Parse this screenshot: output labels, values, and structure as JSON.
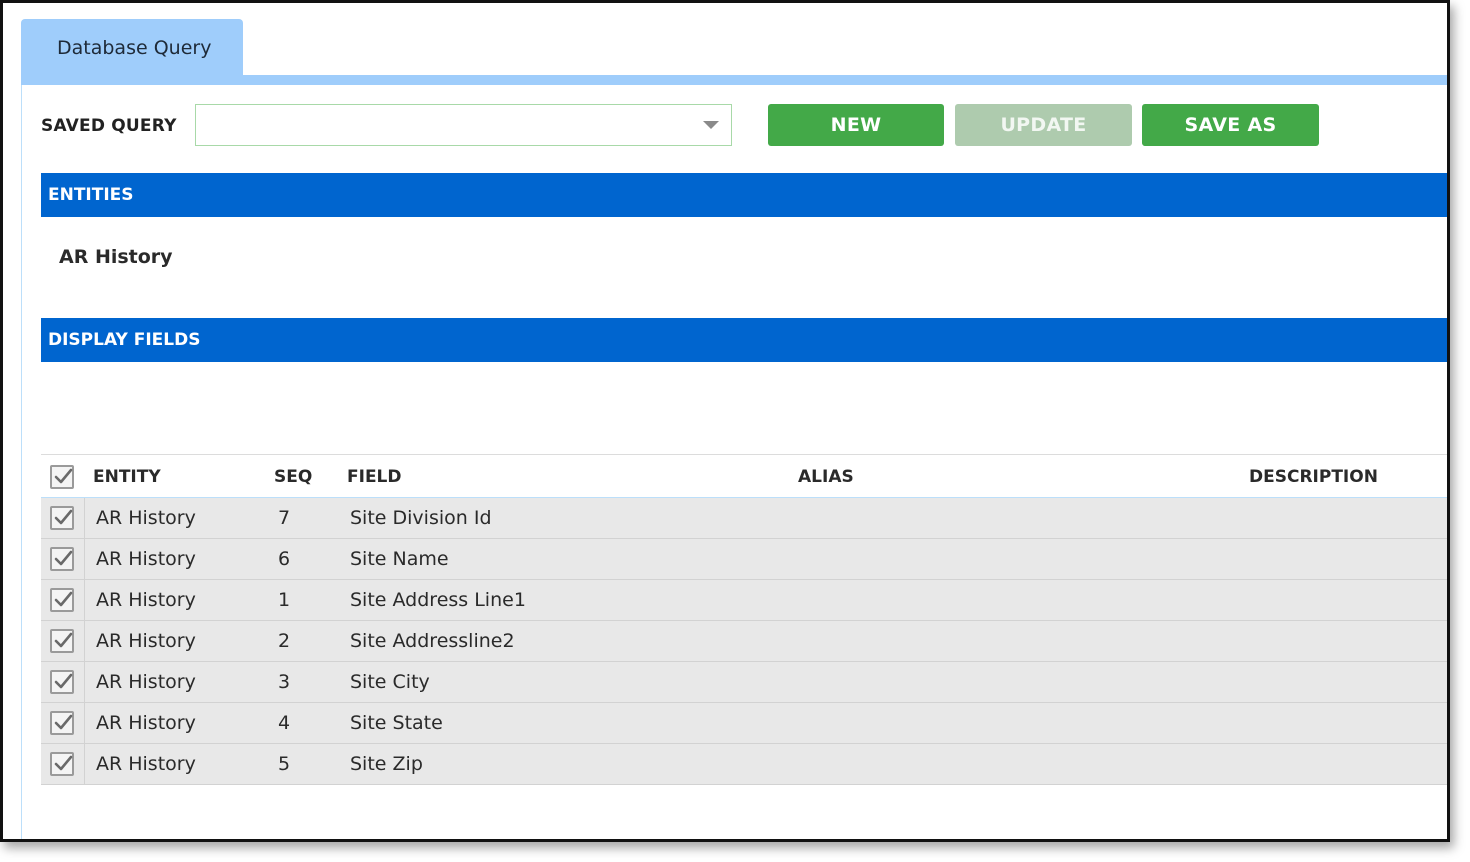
{
  "tab": {
    "label": "Database Query"
  },
  "saved_query": {
    "label": "SAVED QUERY",
    "value": ""
  },
  "buttons": {
    "new": "NEW",
    "update": "UPDATE",
    "save_as": "SAVE AS"
  },
  "sections": {
    "entities": "ENTITIES",
    "display_fields": "DISPLAY FIELDS"
  },
  "entities": [
    "AR History"
  ],
  "table": {
    "headers": {
      "entity": "ENTITY",
      "seq": "SEQ",
      "field": "FIELD",
      "alias": "ALIAS",
      "description": "DESCRIPTION"
    },
    "all_checked": true,
    "rows": [
      {
        "checked": true,
        "entity": "AR History",
        "seq": "7",
        "field": "Site Division Id",
        "alias": "",
        "description": ""
      },
      {
        "checked": true,
        "entity": "AR History",
        "seq": "6",
        "field": "Site Name",
        "alias": "",
        "description": ""
      },
      {
        "checked": true,
        "entity": "AR History",
        "seq": "1",
        "field": "Site Address Line1",
        "alias": "",
        "description": ""
      },
      {
        "checked": true,
        "entity": "AR History",
        "seq": "2",
        "field": "Site Addressline2",
        "alias": "",
        "description": ""
      },
      {
        "checked": true,
        "entity": "AR History",
        "seq": "3",
        "field": "Site City",
        "alias": "",
        "description": ""
      },
      {
        "checked": true,
        "entity": "AR History",
        "seq": "4",
        "field": "Site State",
        "alias": "",
        "description": ""
      },
      {
        "checked": true,
        "entity": "AR History",
        "seq": "5",
        "field": "Site Zip",
        "alias": "",
        "description": ""
      }
    ]
  },
  "colors": {
    "tab": "#9fcdfb",
    "section_bar": "#0065cf",
    "button_green": "#43a948",
    "button_disabled": "#aecbae",
    "row_bg": "#e8e8e8"
  },
  "icons": {
    "select_caret": "chevron-down-icon",
    "checkbox": "checkmark-icon"
  }
}
